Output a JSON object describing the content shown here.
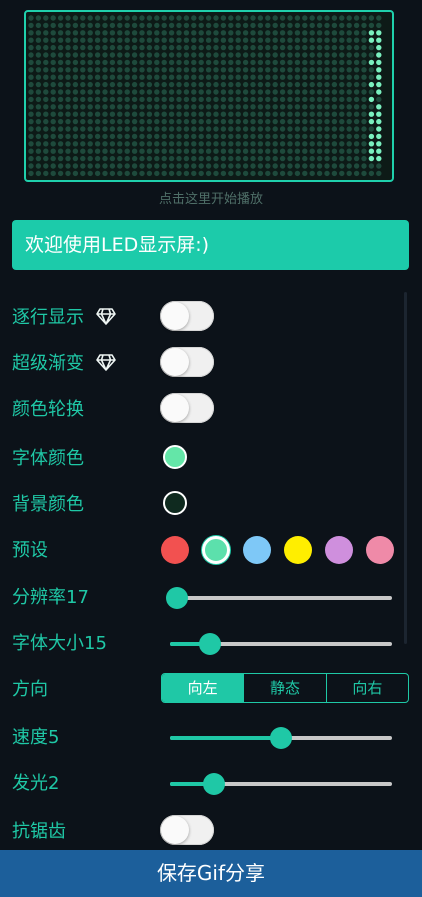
{
  "led_display": {
    "border_color": "#1fd0ac",
    "off_dot_color": "#1e4a3c",
    "on_dot_color": "#7af0bf",
    "hint": "点击这里开始播放"
  },
  "welcome_text": "欢迎使用LED显示屏:)",
  "settings": {
    "line_by_line": {
      "label": "逐行显示",
      "premium_icon": "diamond-icon",
      "on": false
    },
    "super_gradient": {
      "label": "超级渐变",
      "premium_icon": "diamond-icon",
      "on": false
    },
    "color_cycle": {
      "label": "颜色轮换",
      "on": false
    },
    "font_color": {
      "label": "字体颜色",
      "color": "#64e6a8"
    },
    "bg_color": {
      "label": "背景颜色",
      "color": "#0f2a1f"
    },
    "presets": {
      "label": "预设",
      "colors": [
        "#f25150",
        "#5ce0ac",
        "#7ec8f7",
        "#ffee00",
        "#cf8fdd",
        "#ef8aa8"
      ],
      "selected_index": 1
    },
    "resolution": {
      "label": "分辨率17",
      "value_fraction": 0.03
    },
    "font_size": {
      "label": "字体大小15",
      "value_fraction": 0.18
    },
    "direction": {
      "label": "方向",
      "options": [
        "向左",
        "静态",
        "向右"
      ],
      "selected_index": 0
    },
    "speed": {
      "label": "速度5",
      "value_fraction": 0.5
    },
    "glow": {
      "label": "发光2",
      "value_fraction": 0.2
    },
    "antialias": {
      "label": "抗锯齿",
      "on": false
    }
  },
  "save_button_label": "保存Gif分享"
}
